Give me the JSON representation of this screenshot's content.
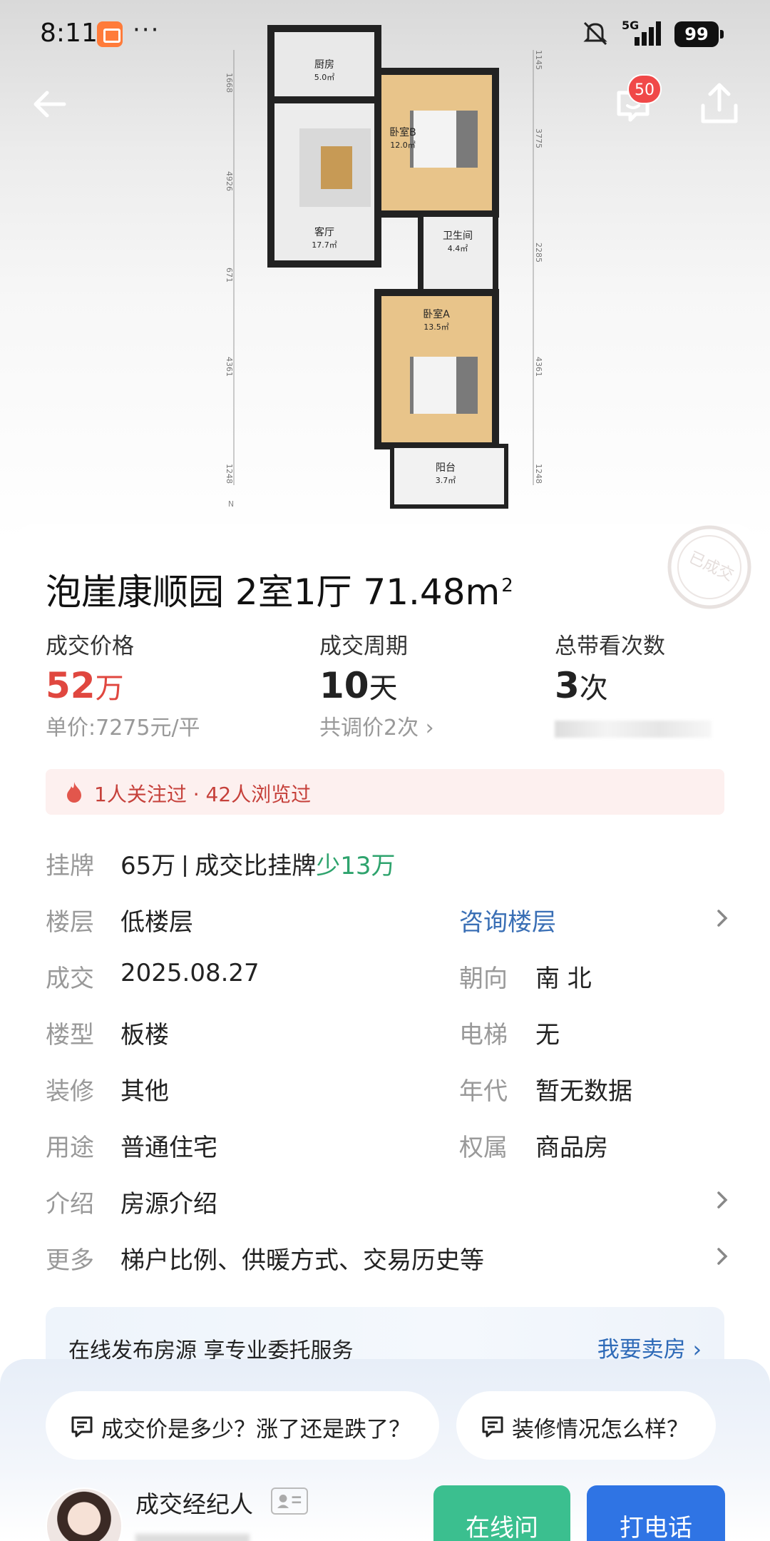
{
  "status": {
    "time": "8:11",
    "dots": "···",
    "network": "5G",
    "battery": "99"
  },
  "nav": {
    "message_badge": "50"
  },
  "floorplan": {
    "rooms": [
      {
        "name": "厨房",
        "area": "5.0㎡"
      },
      {
        "name": "卧室B",
        "area": "12.0㎡"
      },
      {
        "name": "客厅",
        "area": "17.7㎡"
      },
      {
        "name": "卫生间",
        "area": "4.4㎡"
      },
      {
        "name": "卧室A",
        "area": "13.5㎡"
      },
      {
        "name": "阳台",
        "area": "3.7㎡"
      }
    ],
    "left_dims": [
      "1668",
      "4926",
      "671",
      "4361",
      "1248"
    ],
    "right_dims": [
      "1145",
      "3775",
      "2285",
      "4361",
      "1248"
    ],
    "compass": "N",
    "stamp": "已成交"
  },
  "listing": {
    "title": "泡崖康顺园 2室1厅 71.48m",
    "title_sup": "2",
    "stats": [
      {
        "label": "成交价格",
        "value": "52",
        "unit": "万",
        "sub": "单价:7275元/平"
      },
      {
        "label": "成交周期",
        "value": "10",
        "unit": "天",
        "sub": "共调价2次 ›"
      },
      {
        "label": "总带看次数",
        "value": "3",
        "unit": "次"
      }
    ],
    "attention": "1人关注过 · 42人浏览过",
    "rows": {
      "listing_price": {
        "label": "挂牌",
        "value": "65万",
        "compare": "成交比挂牌",
        "diff": "少13万"
      },
      "floor": {
        "label": "楼层",
        "value": "低楼层",
        "link": "咨询楼层"
      },
      "deal": {
        "label": "成交",
        "value": "2025.08.27",
        "label2": "朝向",
        "value2": "南 北"
      },
      "type": {
        "label": "楼型",
        "value": "板楼",
        "label2": "电梯",
        "value2": "无"
      },
      "decor": {
        "label": "装修",
        "value": "其他",
        "label2": "年代",
        "value2": "暂无数据"
      },
      "usage": {
        "label": "用途",
        "value": "普通住宅",
        "label2": "权属",
        "value2": "商品房"
      },
      "intro": {
        "label": "介绍",
        "value": "房源介绍"
      },
      "more": {
        "label": "更多",
        "value": "梯户比例、供暖方式、交易历史等"
      }
    },
    "promo": {
      "text": "在线发布房源 享专业委托服务",
      "link": "我要卖房 ›"
    }
  },
  "bottom": {
    "chips": [
      "成交价是多少？涨了还是跌了？",
      "装修情况怎么样？"
    ],
    "agent_title": "成交经纪人",
    "ask_button": "在线问",
    "call_button": "打电话"
  },
  "colors": {
    "price_red": "#e0473f",
    "discount_green": "#2ea36d",
    "link_blue": "#3a6fb5",
    "ask_green": "#3bbf8f",
    "call_blue": "#2f74e4"
  }
}
